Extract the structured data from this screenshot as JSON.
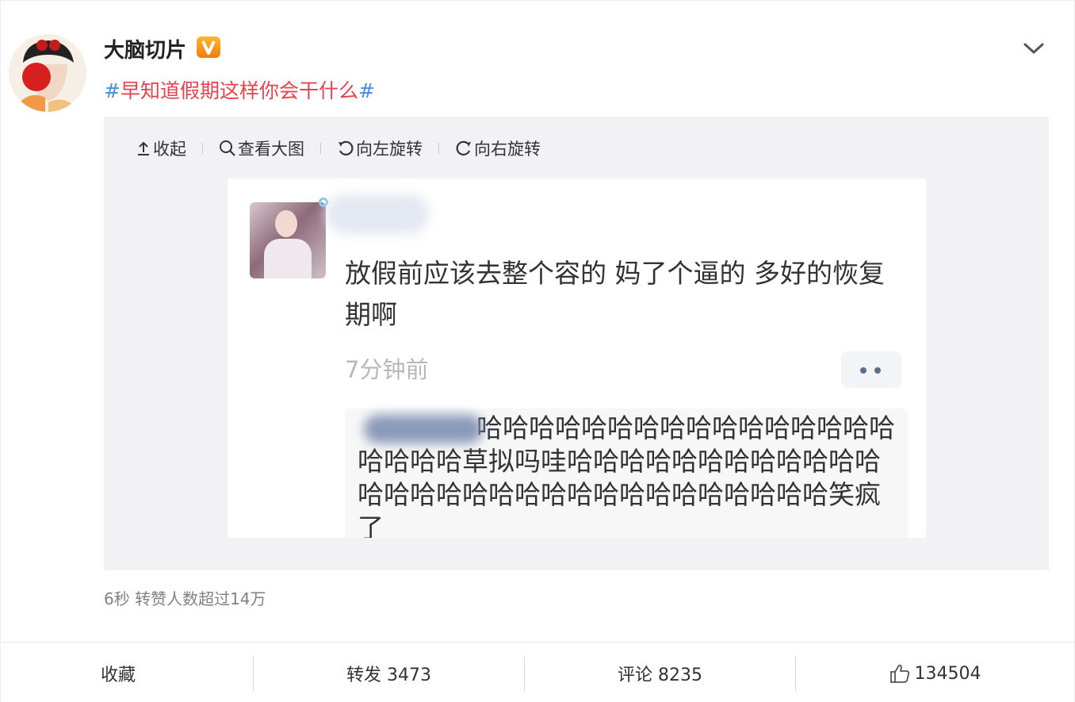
{
  "post": {
    "username": "大脑切片",
    "verified_badge": "V",
    "topic_hash": "#",
    "topic_text": "早知道假期这样你会干什么",
    "meta": "6秒 转赞人数超过14万"
  },
  "toolbar": {
    "collapse": "收起",
    "view_large": "查看大图",
    "rotate_left": "向左旋转",
    "rotate_right": "向右旋转"
  },
  "image": {
    "post_text": "放假前应该去整个容的 妈了个逼的 多好的恢复期啊",
    "time": "7分钟前",
    "reply_text": "哈哈哈哈哈哈哈哈哈哈哈哈哈哈哈哈哈哈哈哈草拟吗哇哈哈哈哈哈哈哈哈哈哈哈哈哈哈哈哈哈哈哈哈哈哈哈哈哈哈哈哈哈哈笑疯了"
  },
  "actions": {
    "favorite": "收藏",
    "repost": "转发 3473",
    "comment": "评论 8235",
    "like": "134504"
  },
  "colors": {
    "topic": "#e6434f",
    "hash": "#4b8de5",
    "verified": "#f39a1d"
  }
}
